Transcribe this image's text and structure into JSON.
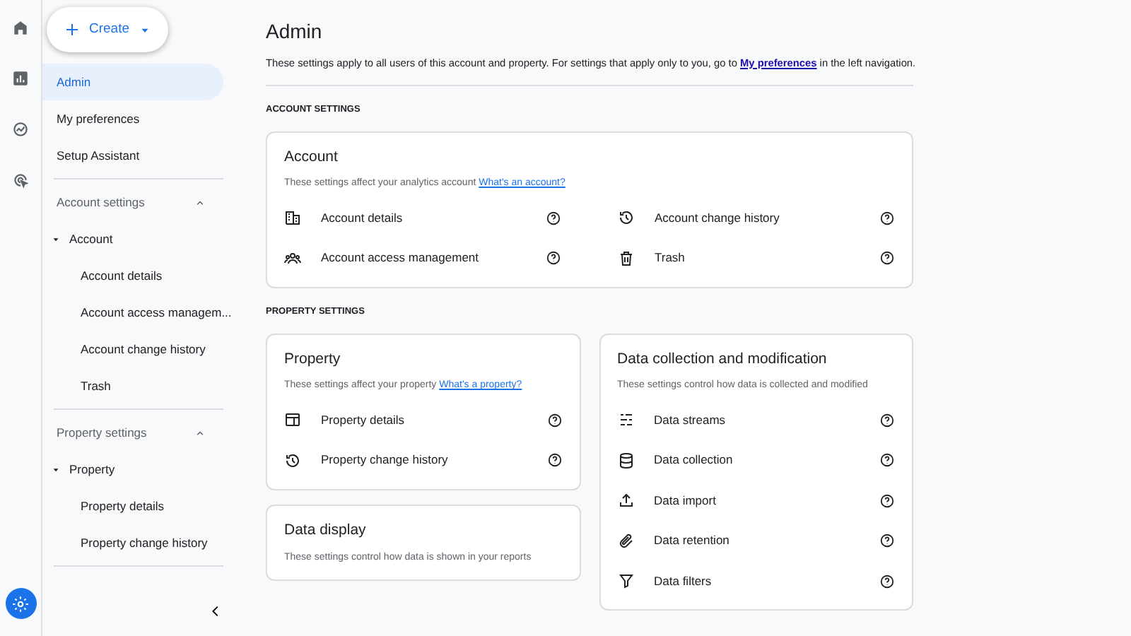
{
  "rail": {
    "items": [
      {
        "kind": "home",
        "selected": false
      },
      {
        "kind": "reports",
        "selected": false
      },
      {
        "kind": "explore",
        "selected": false
      },
      {
        "kind": "advertising",
        "selected": false
      }
    ],
    "settings": {
      "kind": "settings",
      "selected": true
    }
  },
  "sidebar": {
    "create_button": {
      "label": "Create"
    },
    "nav": [
      {
        "label": "Admin",
        "selected": true
      },
      {
        "label": "My preferences",
        "selected": false
      },
      {
        "label": "Setup Assistant",
        "selected": false
      }
    ],
    "sections": [
      {
        "title": "Account settings",
        "expanded": true,
        "groups": [
          {
            "label": "Account",
            "expanded": true,
            "children": [
              {
                "label": "Account details"
              },
              {
                "label": "Account access managem..."
              },
              {
                "label": "Account change history"
              },
              {
                "label": "Trash"
              }
            ]
          }
        ]
      },
      {
        "title": "Property settings",
        "expanded": true,
        "groups": [
          {
            "label": "Property",
            "expanded": true,
            "children": [
              {
                "label": "Property details"
              },
              {
                "label": "Property change history"
              }
            ]
          }
        ]
      }
    ]
  },
  "main": {
    "title": "Admin",
    "intro": {
      "before": "These settings apply to all users of this account and property. For settings that apply only to you, go to ",
      "link": "My preferences",
      "after": " in the left navigation."
    },
    "sections": [
      {
        "heading": "ACCOUNT SETTINGS",
        "columns": [
          [
            {
              "title": "Account",
              "description": "These settings affect your analytics account",
              "link": "What's an account?",
              "item_columns": [
                [
                  {
                    "kind": "building",
                    "label": "Account details"
                  },
                  {
                    "kind": "people",
                    "label": "Account access management"
                  }
                ],
                [
                  {
                    "kind": "history",
                    "label": "Account change history"
                  },
                  {
                    "kind": "trash",
                    "label": "Trash"
                  }
                ]
              ]
            }
          ]
        ]
      },
      {
        "heading": "PROPERTY SETTINGS",
        "columns": [
          [
            {
              "title": "Property",
              "description": "These settings affect your property",
              "link": "What's a property?",
              "item_columns": [
                [
                  {
                    "kind": "panel",
                    "label": "Property details"
                  },
                  {
                    "kind": "history",
                    "label": "Property change history"
                  }
                ]
              ]
            },
            {
              "title": "Data display",
              "description": "These settings control how data is shown in your reports"
            }
          ],
          [
            {
              "title": "Data collection and modification",
              "description": "These settings control how data is collected and modified",
              "item_columns": [
                [
                  {
                    "kind": "streams",
                    "label": "Data streams"
                  },
                  {
                    "kind": "database",
                    "label": "Data collection"
                  },
                  {
                    "kind": "upload",
                    "label": "Data import"
                  },
                  {
                    "kind": "clip",
                    "label": "Data retention"
                  },
                  {
                    "kind": "filter",
                    "label": "Data filters"
                  }
                ]
              ]
            }
          ]
        ]
      }
    ]
  }
}
